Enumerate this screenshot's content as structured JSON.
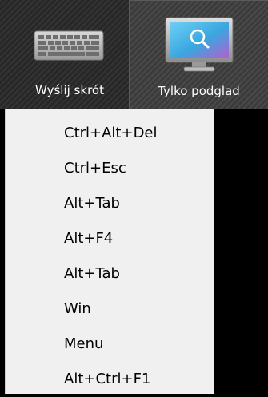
{
  "toolbar": {
    "send_shortcut_label": "Wyślij skrót",
    "view_only_label": "Tylko podgląd",
    "icons": {
      "send_shortcut": "keyboard-icon",
      "view_only": "monitor-search-icon"
    }
  },
  "menu": {
    "items": [
      {
        "label": "Ctrl+Alt+Del"
      },
      {
        "label": "Ctrl+Esc"
      },
      {
        "label": "Alt+Tab"
      },
      {
        "label": "Alt+F4"
      },
      {
        "label": "Alt+Tab"
      },
      {
        "label": "Win"
      },
      {
        "label": "Menu"
      },
      {
        "label": "Alt+Ctrl+F1"
      }
    ]
  },
  "colors": {
    "toolbar_bg": "#2b2b2b",
    "menu_bg": "#f0f0f0",
    "monitor_screen": "#4db6e8",
    "keyboard_keys": "#e8e8e8"
  }
}
